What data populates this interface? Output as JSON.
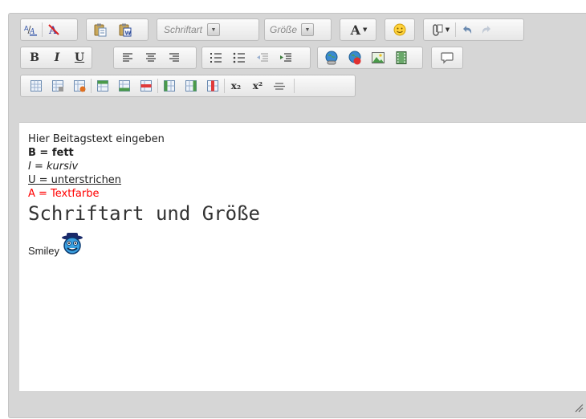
{
  "toolbar": {
    "font_placeholder": "Schriftart",
    "size_placeholder": "Größe",
    "row1": [
      "text-color-icon",
      "remove-format-icon",
      "paste-icon",
      "paste-word-icon",
      "font-select",
      "size-select",
      "font-size-menu-icon",
      "smiley-icon",
      "attachment-icon",
      "undo-icon",
      "redo-icon"
    ],
    "row2": [
      "bold",
      "italic",
      "underline",
      "align-left",
      "align-center",
      "align-right",
      "numbered-list",
      "bullet-list",
      "outdent",
      "indent",
      "insert-link",
      "remove-link",
      "insert-image",
      "insert-video",
      "speech-bubble"
    ],
    "row3": [
      "table",
      "table-properties",
      "delete-table",
      "insert-row-before",
      "insert-row-after",
      "delete-row",
      "insert-col-before",
      "insert-col-after",
      "delete-col",
      "subscript",
      "superscript",
      "horizontal-rule"
    ]
  },
  "labels": {
    "bold": "B",
    "italic": "I",
    "underline": "U",
    "font_size_a": "A",
    "subscript": "x₂",
    "superscript": "x²"
  },
  "content": {
    "line1": "Hier Beitagstext eingeben",
    "line2_prefix": "B = ",
    "line2_bold": "fett",
    "line3_prefix": "I = ",
    "line3_italic": "kursiv",
    "line4": "U = unterstrichen",
    "line5": "A = Textfarbe",
    "line6": "Schriftart und Größe",
    "line7": "Smiley"
  },
  "colors": {
    "text_red": "#ff0000",
    "editor_bg": "#d6d6d6"
  }
}
